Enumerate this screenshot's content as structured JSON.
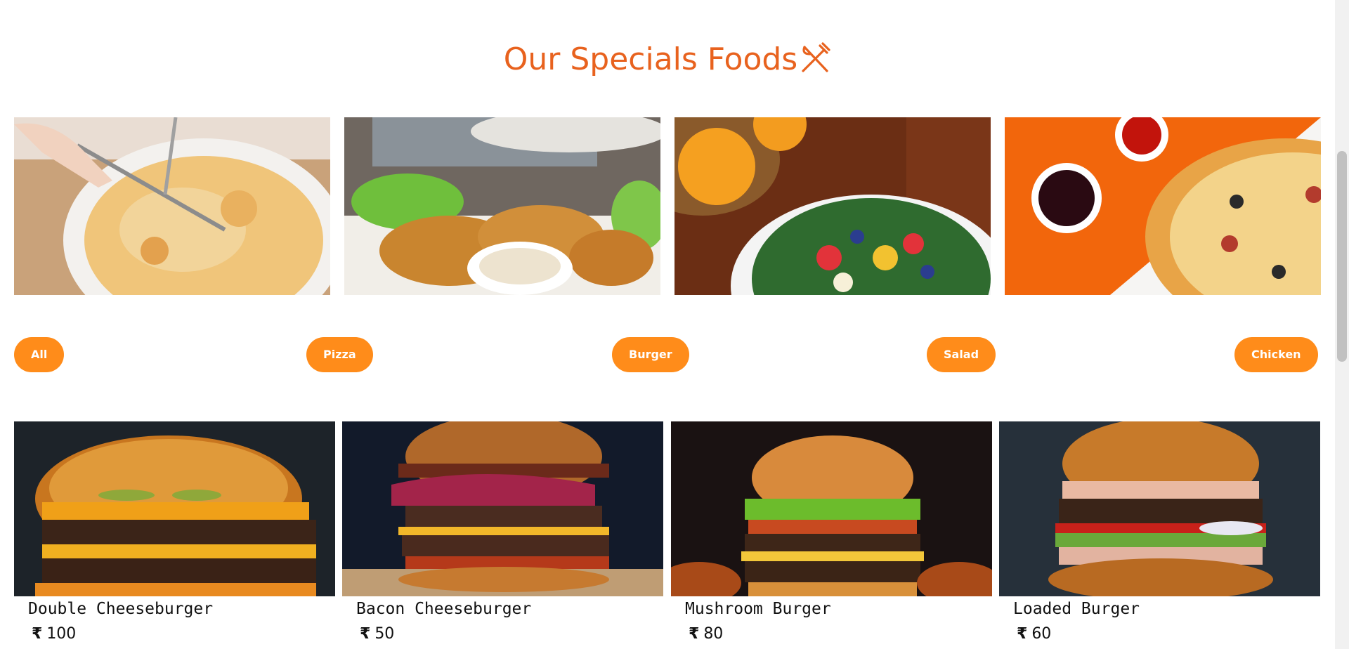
{
  "section": {
    "title": "Our Specials Foods",
    "title_icon": "fork-knife-icon"
  },
  "gallery": [
    {
      "alt": "Pizza being sliced"
    },
    {
      "alt": "Fried chicken with dip"
    },
    {
      "alt": "Fruit salad bowl"
    },
    {
      "alt": "Pizza with sauces"
    }
  ],
  "filters": [
    {
      "label": "All"
    },
    {
      "label": "Pizza"
    },
    {
      "label": "Burger"
    },
    {
      "label": "Salad"
    },
    {
      "label": "Chicken"
    }
  ],
  "products": [
    {
      "name": "Double Cheeseburger",
      "currency": "₹",
      "price": "100"
    },
    {
      "name": "Bacon Cheeseburger",
      "currency": "₹",
      "price": "50"
    },
    {
      "name": "Mushroom Burger",
      "currency": "₹",
      "price": "80"
    },
    {
      "name": "Loaded Burger",
      "currency": "₹",
      "price": "60"
    }
  ],
  "colors": {
    "accent": "#e8621e",
    "button": "#ff8c1a"
  }
}
